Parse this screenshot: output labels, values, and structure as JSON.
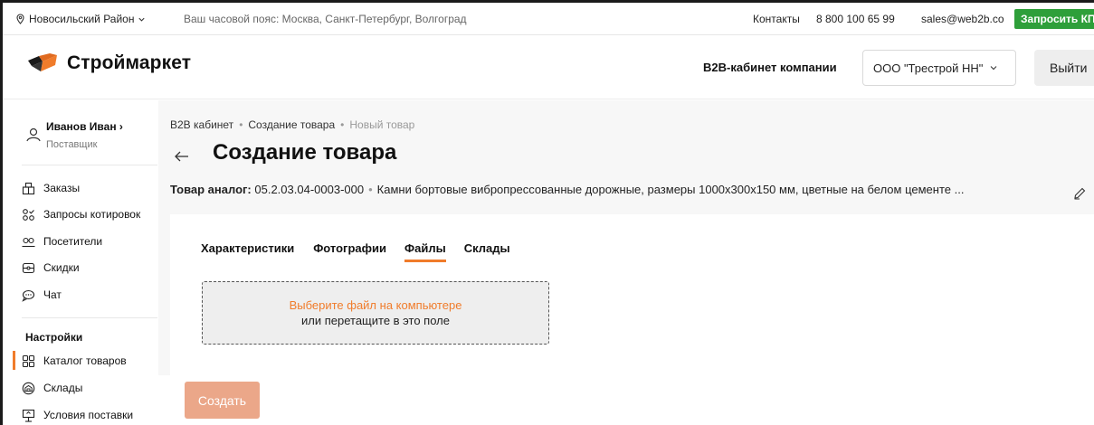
{
  "topbar": {
    "region": "Новосильский Район",
    "timezone": "Ваш часовой пояс: Москва, Санкт-Петербург, Волгоград",
    "contacts": "Контакты",
    "phone": "8 800 100 65 99",
    "email": "sales@web2b.co",
    "request_kp": "Запросить КП"
  },
  "header": {
    "logo_text": "Строймаркет",
    "b2b_label": "B2B-кабинет компании",
    "company": "ООО \"Трестрой НН\"",
    "logout": "Выйти"
  },
  "sidebar": {
    "user_name": "Иванов Иван ›",
    "user_role": "Поставщик",
    "items": [
      {
        "label": "Заказы",
        "icon": "orders-icon"
      },
      {
        "label": "Запросы котировок",
        "icon": "quotes-icon"
      },
      {
        "label": "Посетители",
        "icon": "visitors-icon"
      },
      {
        "label": "Скидки",
        "icon": "discounts-icon"
      },
      {
        "label": "Чат",
        "icon": "chat-icon"
      }
    ],
    "settings_heading": "Настройки",
    "settings_items": [
      {
        "label": "Каталог товаров",
        "icon": "catalog-icon",
        "active": true
      },
      {
        "label": "Склады",
        "icon": "warehouse-icon"
      },
      {
        "label": "Условия поставки",
        "icon": "delivery-icon"
      }
    ]
  },
  "breadcrumb": {
    "items": [
      "B2B кабинет",
      "Создание товара",
      "Новый товар"
    ]
  },
  "page": {
    "title": "Создание товара",
    "analog_label": "Товар аналог:",
    "analog_code": "05.2.03.04-0003-000",
    "analog_desc": "Камни бортовые вибропрессованные дорожные, размеры 1000х300х150 мм, цветные на белом цементе ..."
  },
  "tabs": [
    "Характеристики",
    "Фотографии",
    "Файлы",
    "Склады"
  ],
  "active_tab": "Файлы",
  "dropzone": {
    "link": "Выберите файл на компьютере",
    "text": "или перетащите в это поле"
  },
  "create_button": "Создать",
  "colors": {
    "accent": "#f07c2b",
    "green": "#2e9f3a",
    "create_disabled": "#eba789"
  }
}
